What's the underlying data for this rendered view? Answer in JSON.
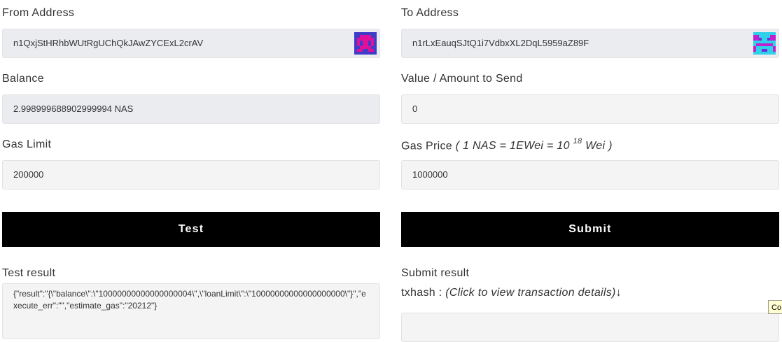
{
  "from": {
    "label": "From Address",
    "value": "n1QxjStHRhbWUtRgUChQkJAwZYCExL2crAV",
    "avatar_icon": "identicon-magenta-blue"
  },
  "to": {
    "label": "To Address",
    "value": "n1rLxEauqSJtQ1i7VdbxXL2DqL5959aZ89F",
    "avatar_icon": "identicon-cyan-magenta"
  },
  "balance": {
    "label": "Balance",
    "value": "2.998999688902999994 NAS"
  },
  "amount": {
    "label": "Value / Amount to Send",
    "value": "0"
  },
  "gas_limit": {
    "label": "Gas Limit",
    "value": "200000"
  },
  "gas_price": {
    "label": "Gas Price",
    "hint_prefix": "( 1 NAS = 1EWei = 10",
    "hint_exp": "18",
    "hint_suffix": "Wei )",
    "value": "1000000"
  },
  "buttons": {
    "test": "Test",
    "submit": "Submit"
  },
  "test_result": {
    "label": "Test result",
    "text": "{\"result\":\"{\\\"balance\\\":\\\"10000000000000000004\\\",\\\"loanLimit\\\":\\\"10000000000000000000\\\"}\",\"execute_err\":\"\",\"estimate_gas\":\"20212\"}"
  },
  "submit_result": {
    "label": "Submit result",
    "txhash_label": "txhash :",
    "txhash_hint": "(Click to view transaction details)↓",
    "txhash_value": ""
  },
  "tooltip": {
    "text": "Co"
  },
  "colors": {
    "button_bg": "#000000",
    "readonly_bg": "#eaecef",
    "field_bg": "#f4f4f4"
  }
}
